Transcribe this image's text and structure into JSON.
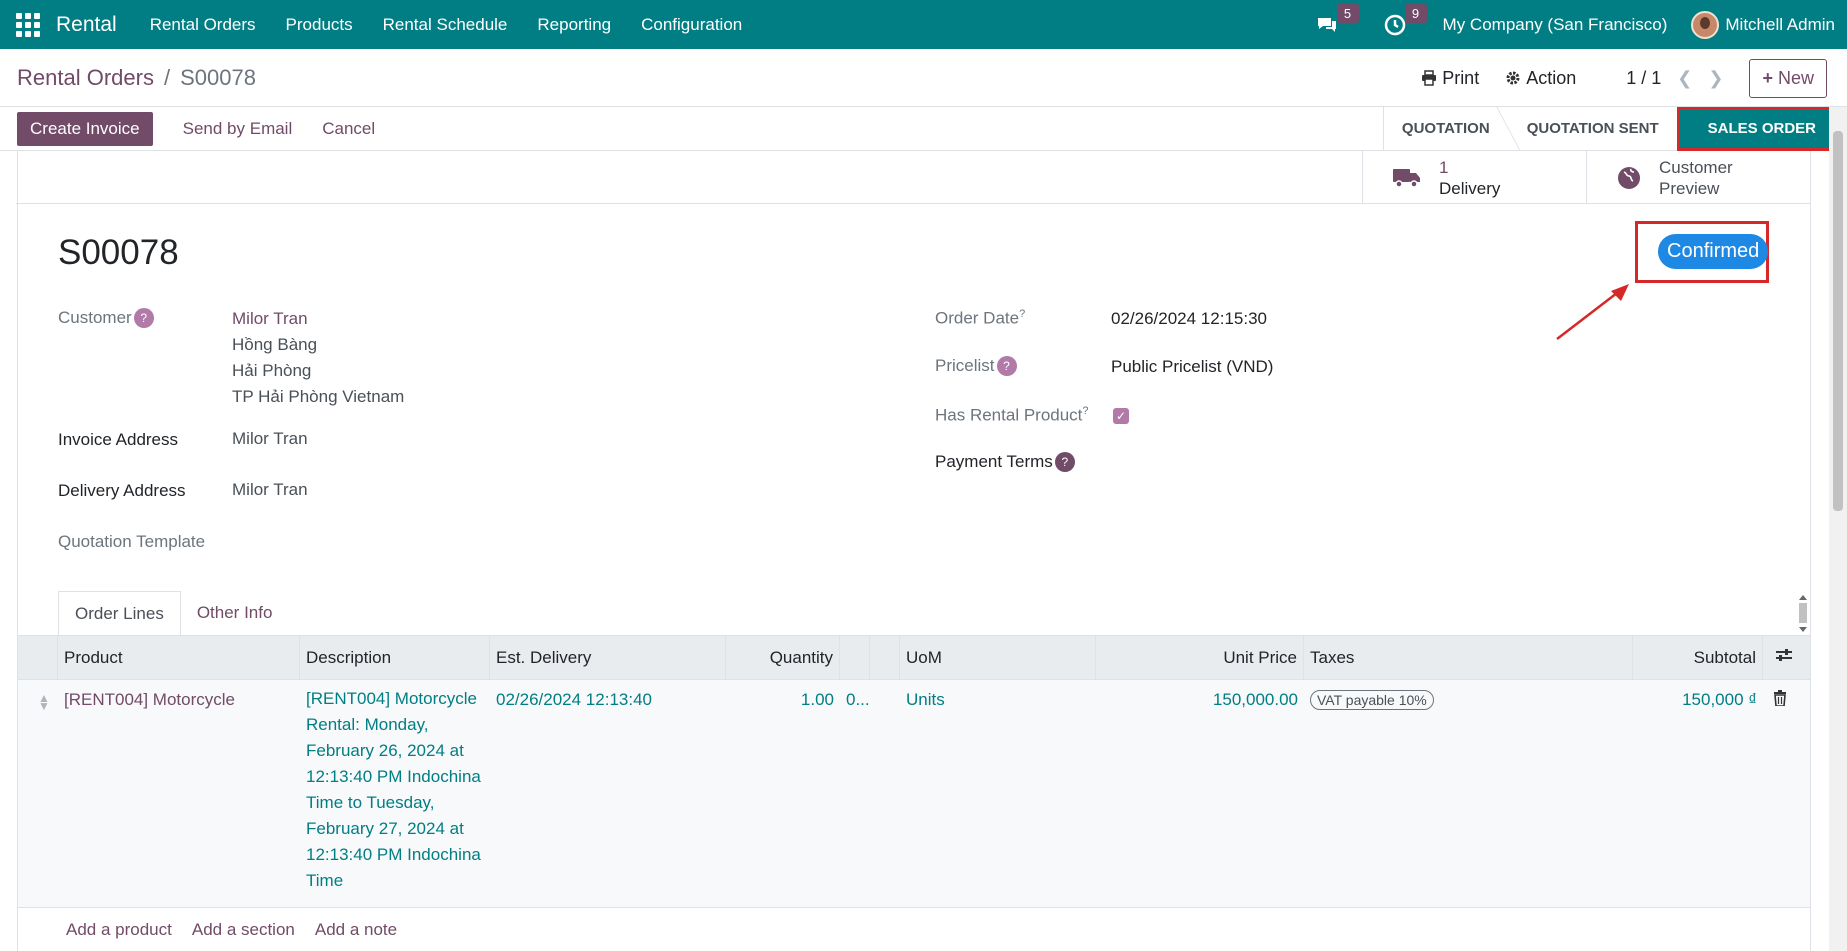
{
  "topbar": {
    "app_name": "Rental",
    "menu": [
      "Rental Orders",
      "Products",
      "Rental Schedule",
      "Reporting",
      "Configuration"
    ],
    "messages_count": "5",
    "activities_count": "9",
    "company": "My Company (San Francisco)",
    "user": "Mitchell Admin"
  },
  "control": {
    "breadcrumb_parent": "Rental Orders",
    "breadcrumb_separator": "/",
    "breadcrumb_current": "S00078",
    "print_label": "Print",
    "action_label": "Action",
    "pager": "1 / 1",
    "new_label": "New"
  },
  "statusbar": {
    "create_invoice": "Create Invoice",
    "send_email": "Send by Email",
    "cancel": "Cancel",
    "stages": [
      "QUOTATION",
      "QUOTATION SENT",
      "SALES ORDER"
    ],
    "active_stage": "SALES ORDER"
  },
  "smart_buttons": {
    "delivery_count": "1",
    "delivery_label": "Delivery",
    "preview_line1": "Customer",
    "preview_line2": "Preview"
  },
  "record": {
    "name": "S00078",
    "status": "Confirmed",
    "customer_label": "Customer",
    "customer_name": "Milor Tran",
    "customer_addr1": "Hồng Bàng",
    "customer_addr2": "Hải Phòng",
    "customer_addr3": "TP Hải Phòng Vietnam",
    "invoice_label": "Invoice Address",
    "invoice_value": "Milor Tran",
    "delivery_label": "Delivery Address",
    "delivery_value": "Milor Tran",
    "template_label": "Quotation Template",
    "order_date_label": "Order Date",
    "order_date_value": "02/26/2024 12:15:30",
    "pricelist_label": "Pricelist",
    "pricelist_value": "Public Pricelist (VND)",
    "has_rental_label": "Has Rental Product",
    "has_rental_value": true,
    "payment_terms_label": "Payment Terms",
    "help_mark": "?"
  },
  "tabs": [
    "Order Lines",
    "Other Info"
  ],
  "table": {
    "headers": {
      "product": "Product",
      "description": "Description",
      "est_delivery": "Est. Delivery",
      "quantity": "Quantity",
      "uom": "UoM",
      "unit_price": "Unit Price",
      "taxes": "Taxes",
      "subtotal": "Subtotal"
    },
    "rows": [
      {
        "product": "[RENT004] Motorcycle",
        "description": "[RENT004] Motorcycle Rental: Monday, February 26, 2024 at 12:13:40 PM Indochina Time to Tuesday, February 27, 2024 at 12:13:40 PM Indochina Time",
        "est_delivery": "02/26/2024 12:13:40",
        "quantity": "1.00",
        "extra": "0...",
        "uom": "Units",
        "unit_price": "150,000.00",
        "tax": "VAT payable 10%",
        "subtotal": "150,000 ₫"
      }
    ],
    "add_product": "Add a product",
    "add_section": "Add a section",
    "add_note": "Add a note"
  },
  "colors": {
    "topbar": "#017e84",
    "primary": "#714b67",
    "status_pill": "#1e88e5",
    "highlight": "#d62828"
  }
}
